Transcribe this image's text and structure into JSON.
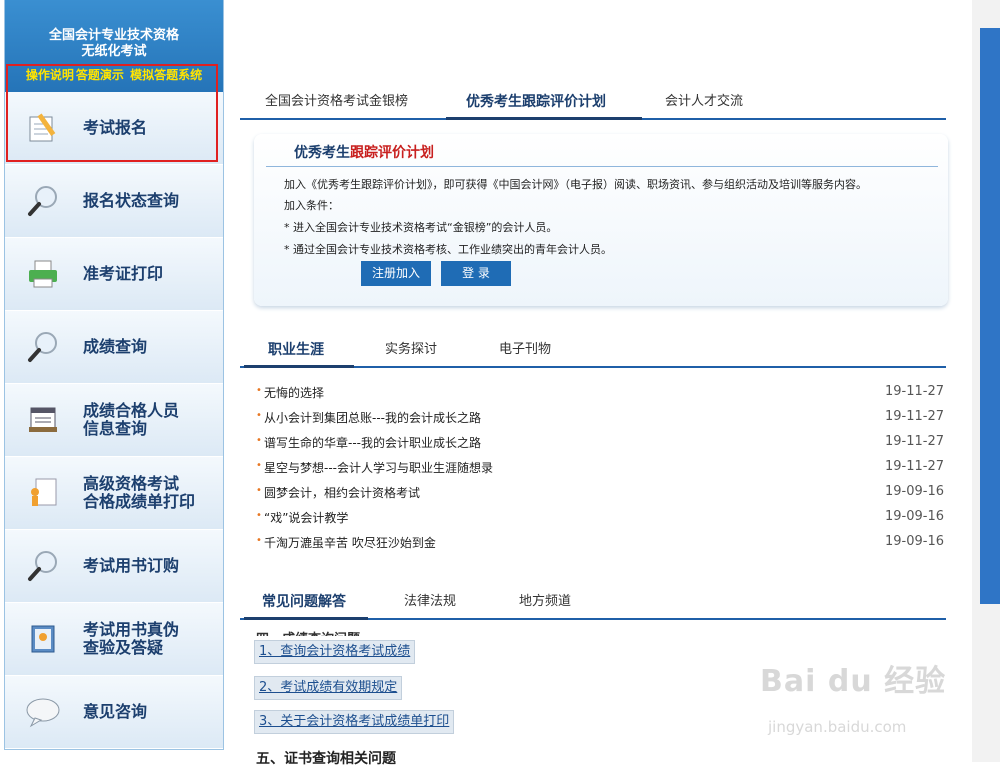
{
  "sidebar": {
    "title_line1": "全国会计专业技术资格",
    "title_line2": "无纸化考试",
    "links": [
      "操作说明",
      "答题演示",
      "模拟答题系统"
    ],
    "items": [
      {
        "label": "考试报名",
        "icon": "pencil-notepad-icon"
      },
      {
        "label": "报名状态查询",
        "icon": "magnifier-icon"
      },
      {
        "label": "准考证打印",
        "icon": "printer-icon"
      },
      {
        "label": "成绩查询",
        "icon": "magnifier-icon"
      },
      {
        "label": "成绩合格人员",
        "label2": "信息查询",
        "icon": "document-list-icon"
      },
      {
        "label": "高级资格考试",
        "label2": "合格成绩单打印",
        "icon": "user-document-icon"
      },
      {
        "label": "考试用书订购",
        "icon": "magnifier-icon"
      },
      {
        "label": "考试用书真伪",
        "label2": "查验及答疑",
        "icon": "book-verify-icon"
      },
      {
        "label": "意见咨询",
        "icon": "chat-bubble-icon"
      }
    ]
  },
  "tabs_top": [
    "全国会计资格考试金银榜",
    "优秀考生跟踪评价计划",
    "会计人才交流"
  ],
  "panel": {
    "title_a": "优秀考生",
    "title_b": "跟踪评价计划",
    "intro": "加入《优秀考生跟踪评价计划》，即可获得《中国会计网》（电子报）阅读、职场资讯、参与组织活动及培训等服务内容。",
    "cond_label": "加入条件：",
    "cond1": "* 进入全国会计专业技术资格考试“金银榜”的会计人员。",
    "cond2": "* 通过全国会计专业技术资格考核、工作业绩突出的青年会计人员。",
    "register": "注册加入",
    "login": "登 录"
  },
  "tabs_mid": [
    "职业生涯",
    "实务探讨",
    "电子刊物"
  ],
  "articles": [
    {
      "title": "无悔的选择",
      "date": "19-11-27"
    },
    {
      "title": "从小会计到集团总账---我的会计成长之路",
      "date": "19-11-27"
    },
    {
      "title": "谱写生命的华章---我的会计职业成长之路",
      "date": "19-11-27"
    },
    {
      "title": "星空与梦想---会计人学习与职业生涯随想录",
      "date": "19-11-27"
    },
    {
      "title": "圆梦会计，相约会计资格考试",
      "date": "19-09-16"
    },
    {
      "title": "“戏”说会计教学",
      "date": "19-09-16"
    },
    {
      "title": "千淘万漉虽辛苦 吹尽狂沙始到金",
      "date": "19-09-16"
    }
  ],
  "tabs_bottom": [
    "常见问题解答",
    "法律法规",
    "地方频道"
  ],
  "faq": {
    "cut_heading": "四、成绩查询问题",
    "links": [
      "1、查询会计资格考试成绩",
      "2、考试成绩有效期规定",
      "3、关于会计资格考试成绩单打印"
    ],
    "section5": "五、证书查询相关问题"
  },
  "watermark": {
    "main": "Bai du 经验",
    "sub": "jingyan.baidu.com"
  },
  "colors": {
    "accent": "#1c3f6e",
    "highlight_border": "#e02020",
    "bullet": "#e87722"
  }
}
